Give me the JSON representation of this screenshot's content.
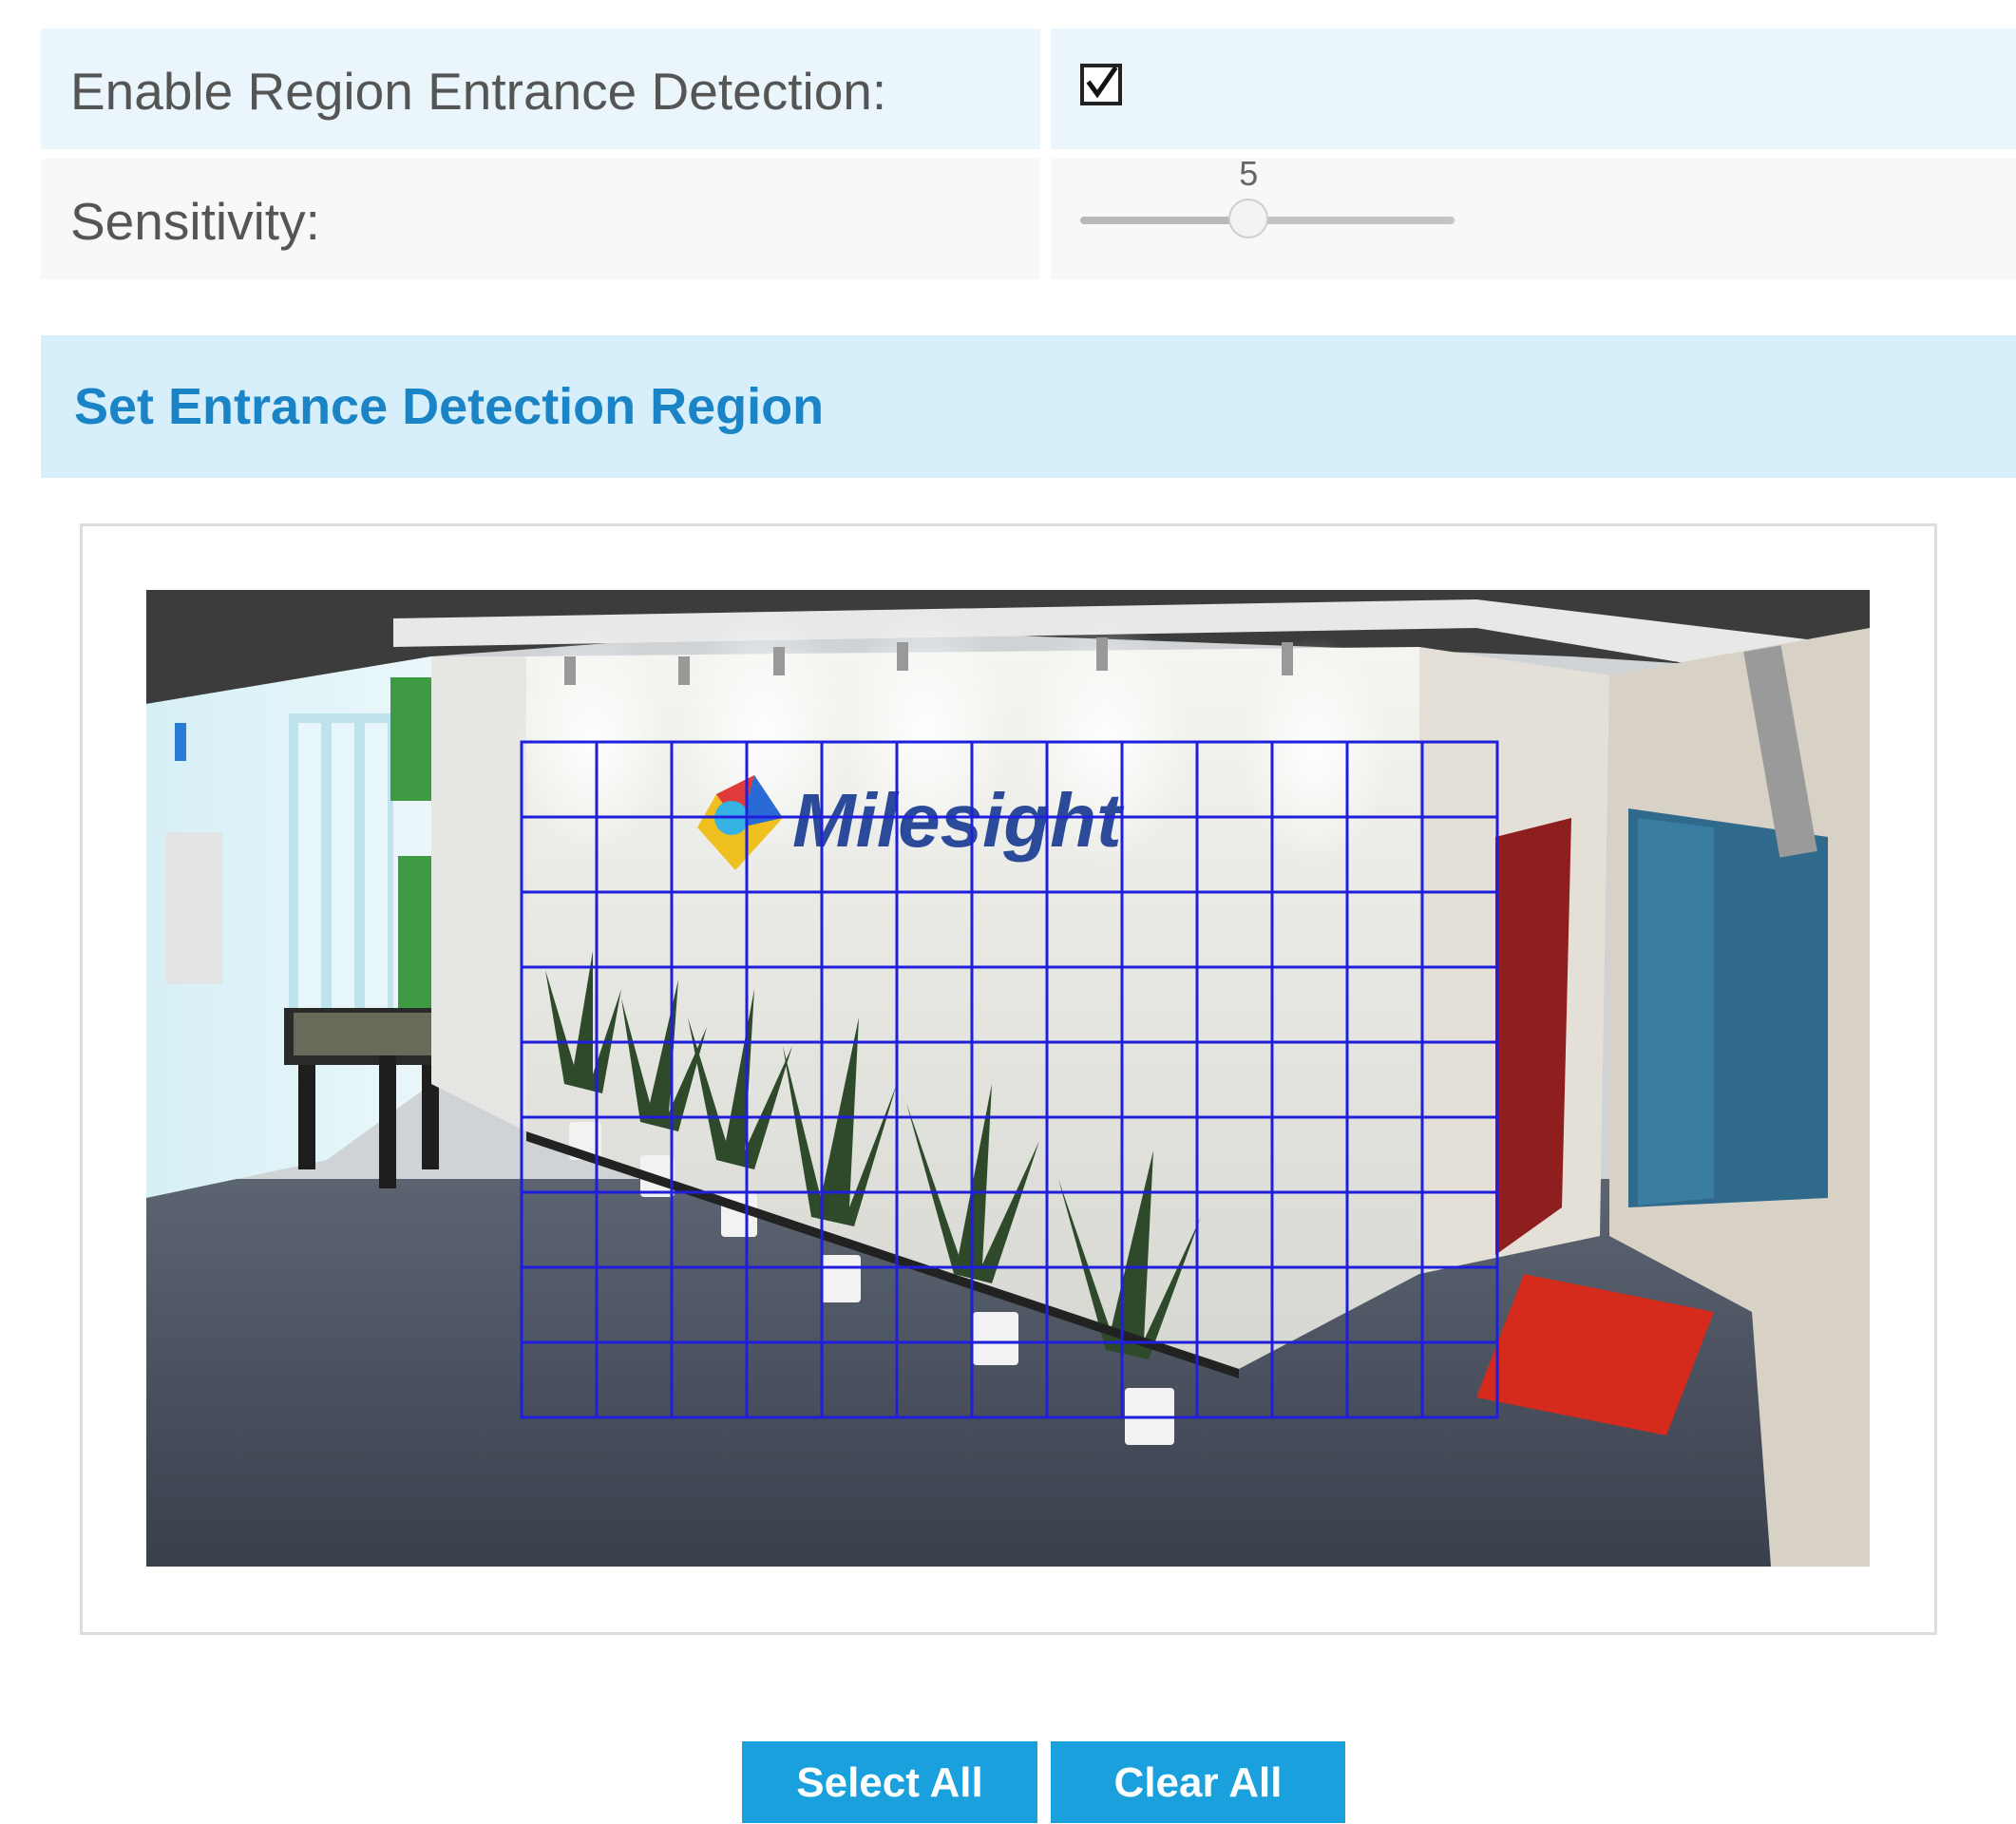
{
  "settings": {
    "enable_label": "Enable Region Entrance Detection:",
    "enable_checked": true,
    "sensitivity_label": "Sensitivity:",
    "sensitivity_value": "5",
    "sensitivity_fraction": 0.45
  },
  "region_section": {
    "title": "Set Entrance Detection Region"
  },
  "camera_view": {
    "logo_text": "Milesight",
    "grid_color": "#1e1edc",
    "grid_columns": 13,
    "grid_rows": 9
  },
  "buttons": {
    "select_all": "Select All",
    "clear_all": "Clear All"
  },
  "colors": {
    "accent": "#1aa0dc",
    "section_title": "#1a84c6",
    "section_bg": "#d6effb",
    "row_bg_1": "#eaf6fc",
    "row_bg_2": "#f8f8f8"
  }
}
